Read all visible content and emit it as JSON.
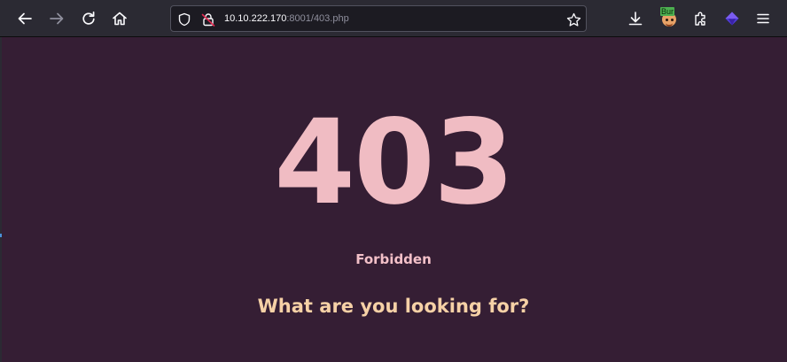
{
  "browser": {
    "url_host": "10.10.222.170",
    "url_rest": ":8001/403.php",
    "extension_badge": "Bur",
    "icons": {
      "back": "arrow-left-icon",
      "forward": "arrow-right-icon",
      "reload": "reload-icon",
      "home": "home-icon",
      "tracking": "shield-icon",
      "insecure": "insecure-lock-icon",
      "bookmark": "star-icon",
      "downloads": "download-icon",
      "extensions": "puzzle-icon",
      "wappalyzer": "diamond-icon",
      "menu": "hamburger-menu-icon"
    }
  },
  "page": {
    "code": "403",
    "status": "Forbidden",
    "question": "What are you looking for?"
  },
  "colors": {
    "background": "#351e34",
    "code": "#f0bcc3",
    "status": "#f3c0c8",
    "question": "#f6d1a6"
  }
}
